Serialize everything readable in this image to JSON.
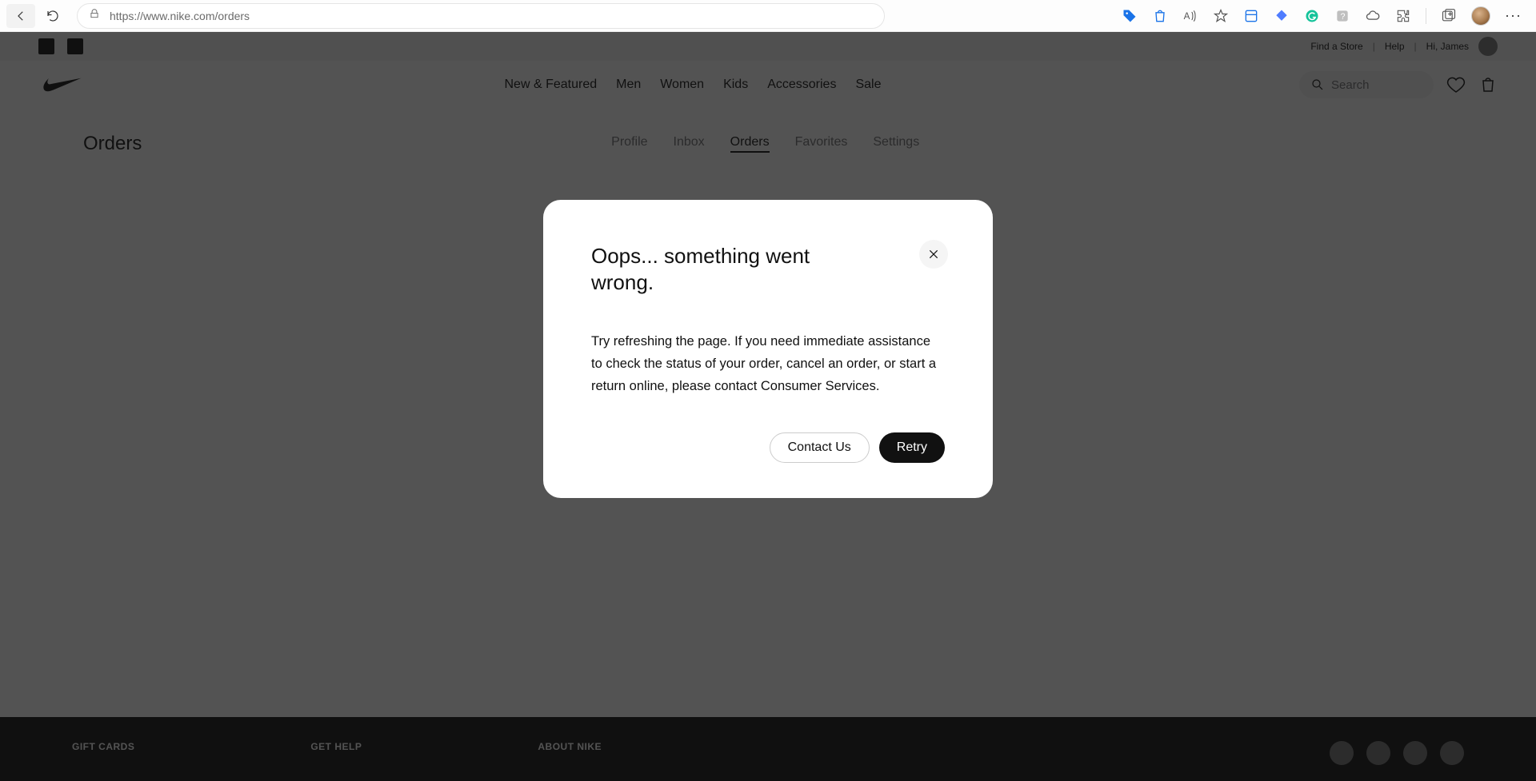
{
  "browser": {
    "url": "https://www.nike.com/orders"
  },
  "top_strip": {
    "links": [
      "Find a Store",
      "Help",
      "Hi, James"
    ]
  },
  "main_nav": {
    "items": [
      "New & Featured",
      "Men",
      "Women",
      "Kids",
      "Accessories",
      "Sale"
    ],
    "search_placeholder": "Search"
  },
  "sub_nav": {
    "title": "Orders",
    "items": [
      "Profile",
      "Inbox",
      "Orders",
      "Favorites",
      "Settings"
    ],
    "active": "Orders"
  },
  "modal": {
    "title": "Oops... something went wrong.",
    "body": "Try refreshing the page. If you need immediate assistance to check the status of your order, cancel an order, or start a return online, please contact Consumer Services.",
    "contact_label": "Contact Us",
    "retry_label": "Retry"
  },
  "footer": {
    "col1": "GIFT CARDS",
    "col2": "GET HELP",
    "col3": "ABOUT NIKE"
  }
}
